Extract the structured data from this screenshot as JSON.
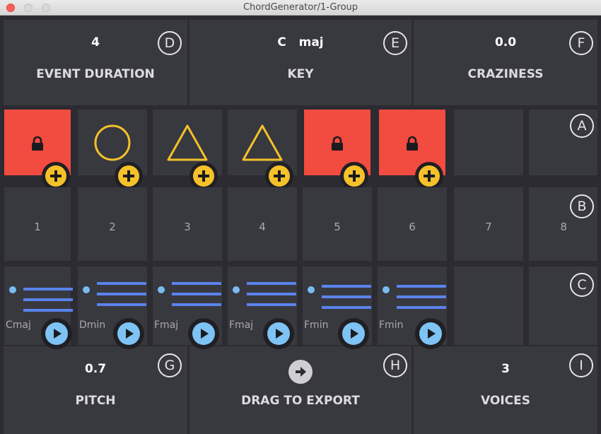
{
  "window": {
    "title": "ChordGenerator/1-Group"
  },
  "top_panels": [
    {
      "value": "4",
      "label": "EVENT DURATION",
      "badge": "D"
    },
    {
      "value": "C   maj",
      "label": "KEY",
      "badge": "E"
    },
    {
      "value": "0.0",
      "label": "CRAZINESS",
      "badge": "F"
    }
  ],
  "bottom_panels": [
    {
      "value": "0.7",
      "label": "PITCH",
      "badge": "G"
    },
    {
      "value": "",
      "label": "DRAG TO EXPORT",
      "badge": "H"
    },
    {
      "value": "3",
      "label": "VOICES",
      "badge": "I"
    }
  ],
  "row_badges": {
    "a": "A",
    "b": "B",
    "c": "C"
  },
  "slots": [
    {
      "state": "locked",
      "number": "1",
      "chord": "Cmaj"
    },
    {
      "state": "circle",
      "number": "2",
      "chord": "Dmin"
    },
    {
      "state": "triangle",
      "number": "3",
      "chord": "Fmaj"
    },
    {
      "state": "triangle",
      "number": "4",
      "chord": "Fmaj"
    },
    {
      "state": "locked",
      "number": "5",
      "chord": "Fmin"
    },
    {
      "state": "locked",
      "number": "6",
      "chord": "Fmin"
    },
    {
      "state": "empty",
      "number": "7",
      "chord": ""
    },
    {
      "state": "empty",
      "number": "8",
      "chord": ""
    }
  ],
  "colors": {
    "locked": "#f24b40",
    "accent_yellow": "#f5c12a",
    "notes_blue": "#5a83ec",
    "play_blue": "#7ec3f4"
  },
  "icons": {
    "lock": "lock-icon",
    "add": "plus-icon",
    "play": "play-icon",
    "export": "arrow-right-icon"
  }
}
